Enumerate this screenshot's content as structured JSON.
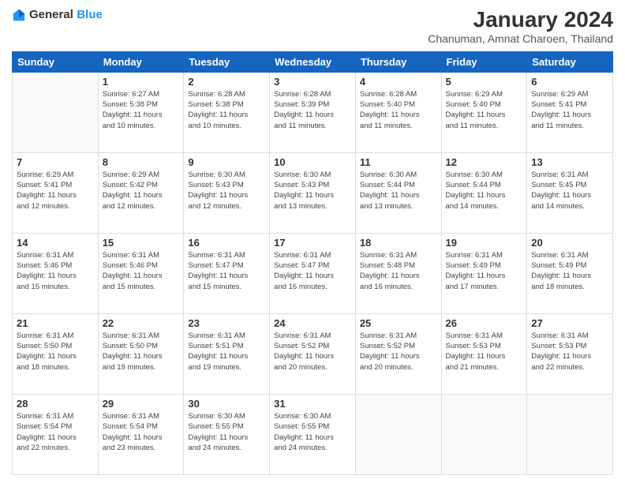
{
  "header": {
    "logo": {
      "general": "General",
      "blue": "Blue"
    },
    "title": "January 2024",
    "subtitle": "Chanuman, Amnat Charoen, Thailand"
  },
  "weekdays": [
    "Sunday",
    "Monday",
    "Tuesday",
    "Wednesday",
    "Thursday",
    "Friday",
    "Saturday"
  ],
  "weeks": [
    [
      {
        "day": "",
        "info": ""
      },
      {
        "day": "1",
        "info": "Sunrise: 6:27 AM\nSunset: 5:38 PM\nDaylight: 11 hours\nand 10 minutes."
      },
      {
        "day": "2",
        "info": "Sunrise: 6:28 AM\nSunset: 5:38 PM\nDaylight: 11 hours\nand 10 minutes."
      },
      {
        "day": "3",
        "info": "Sunrise: 6:28 AM\nSunset: 5:39 PM\nDaylight: 11 hours\nand 11 minutes."
      },
      {
        "day": "4",
        "info": "Sunrise: 6:28 AM\nSunset: 5:40 PM\nDaylight: 11 hours\nand 11 minutes."
      },
      {
        "day": "5",
        "info": "Sunrise: 6:29 AM\nSunset: 5:40 PM\nDaylight: 11 hours\nand 11 minutes."
      },
      {
        "day": "6",
        "info": "Sunrise: 6:29 AM\nSunset: 5:41 PM\nDaylight: 11 hours\nand 11 minutes."
      }
    ],
    [
      {
        "day": "7",
        "info": "Sunrise: 6:29 AM\nSunset: 5:41 PM\nDaylight: 11 hours\nand 12 minutes."
      },
      {
        "day": "8",
        "info": "Sunrise: 6:29 AM\nSunset: 5:42 PM\nDaylight: 11 hours\nand 12 minutes."
      },
      {
        "day": "9",
        "info": "Sunrise: 6:30 AM\nSunset: 5:43 PM\nDaylight: 11 hours\nand 12 minutes."
      },
      {
        "day": "10",
        "info": "Sunrise: 6:30 AM\nSunset: 5:43 PM\nDaylight: 11 hours\nand 13 minutes."
      },
      {
        "day": "11",
        "info": "Sunrise: 6:30 AM\nSunset: 5:44 PM\nDaylight: 11 hours\nand 13 minutes."
      },
      {
        "day": "12",
        "info": "Sunrise: 6:30 AM\nSunset: 5:44 PM\nDaylight: 11 hours\nand 14 minutes."
      },
      {
        "day": "13",
        "info": "Sunrise: 6:31 AM\nSunset: 5:45 PM\nDaylight: 11 hours\nand 14 minutes."
      }
    ],
    [
      {
        "day": "14",
        "info": "Sunrise: 6:31 AM\nSunset: 5:46 PM\nDaylight: 11 hours\nand 15 minutes."
      },
      {
        "day": "15",
        "info": "Sunrise: 6:31 AM\nSunset: 5:46 PM\nDaylight: 11 hours\nand 15 minutes."
      },
      {
        "day": "16",
        "info": "Sunrise: 6:31 AM\nSunset: 5:47 PM\nDaylight: 11 hours\nand 15 minutes."
      },
      {
        "day": "17",
        "info": "Sunrise: 6:31 AM\nSunset: 5:47 PM\nDaylight: 11 hours\nand 16 minutes."
      },
      {
        "day": "18",
        "info": "Sunrise: 6:31 AM\nSunset: 5:48 PM\nDaylight: 11 hours\nand 16 minutes."
      },
      {
        "day": "19",
        "info": "Sunrise: 6:31 AM\nSunset: 5:49 PM\nDaylight: 11 hours\nand 17 minutes."
      },
      {
        "day": "20",
        "info": "Sunrise: 6:31 AM\nSunset: 5:49 PM\nDaylight: 11 hours\nand 18 minutes."
      }
    ],
    [
      {
        "day": "21",
        "info": "Sunrise: 6:31 AM\nSunset: 5:50 PM\nDaylight: 11 hours\nand 18 minutes."
      },
      {
        "day": "22",
        "info": "Sunrise: 6:31 AM\nSunset: 5:50 PM\nDaylight: 11 hours\nand 19 minutes."
      },
      {
        "day": "23",
        "info": "Sunrise: 6:31 AM\nSunset: 5:51 PM\nDaylight: 11 hours\nand 19 minutes."
      },
      {
        "day": "24",
        "info": "Sunrise: 6:31 AM\nSunset: 5:52 PM\nDaylight: 11 hours\nand 20 minutes."
      },
      {
        "day": "25",
        "info": "Sunrise: 6:31 AM\nSunset: 5:52 PM\nDaylight: 11 hours\nand 20 minutes."
      },
      {
        "day": "26",
        "info": "Sunrise: 6:31 AM\nSunset: 5:53 PM\nDaylight: 11 hours\nand 21 minutes."
      },
      {
        "day": "27",
        "info": "Sunrise: 6:31 AM\nSunset: 5:53 PM\nDaylight: 11 hours\nand 22 minutes."
      }
    ],
    [
      {
        "day": "28",
        "info": "Sunrise: 6:31 AM\nSunset: 5:54 PM\nDaylight: 11 hours\nand 22 minutes."
      },
      {
        "day": "29",
        "info": "Sunrise: 6:31 AM\nSunset: 5:54 PM\nDaylight: 11 hours\nand 23 minutes."
      },
      {
        "day": "30",
        "info": "Sunrise: 6:30 AM\nSunset: 5:55 PM\nDaylight: 11 hours\nand 24 minutes."
      },
      {
        "day": "31",
        "info": "Sunrise: 6:30 AM\nSunset: 5:55 PM\nDaylight: 11 hours\nand 24 minutes."
      },
      {
        "day": "",
        "info": ""
      },
      {
        "day": "",
        "info": ""
      },
      {
        "day": "",
        "info": ""
      }
    ]
  ]
}
